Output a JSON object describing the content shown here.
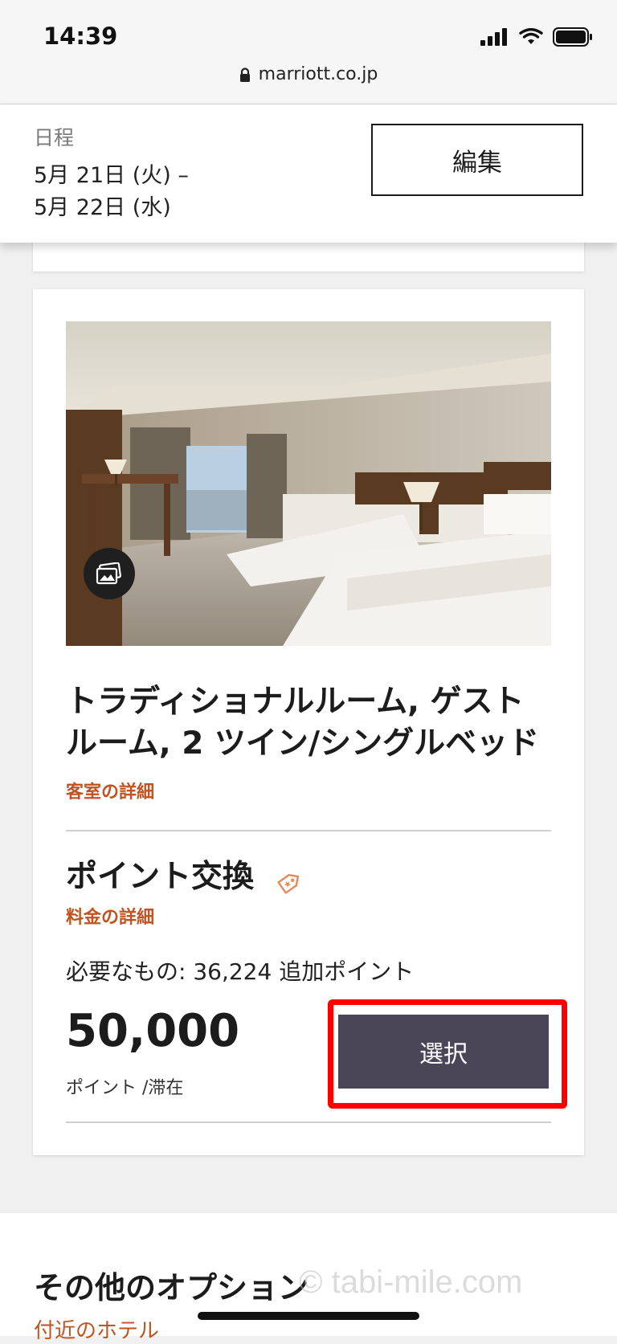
{
  "status_bar": {
    "time": "14:39",
    "url": "marriott.co.jp"
  },
  "header": {
    "date_label": "日程",
    "date_line1": "5月 21日 (火) –",
    "date_line2": "5月 22日 (水)",
    "edit_label": "編集"
  },
  "room": {
    "name": "トラディショナルルーム, ゲストルーム, 2 ツイン/シングルベッド",
    "details_link": "客室の詳細",
    "rate_title": "ポイント交換",
    "rate_details_link": "料金の詳細",
    "needed_text": "必要なもの: 36,224 追加ポイント",
    "price": "50,000",
    "price_unit": "ポイント /滞在",
    "select_label": "選択"
  },
  "other": {
    "title": "その他のオプション",
    "nearby_link": "付近のホテル"
  },
  "watermark": "© tabi-mile.com",
  "colors": {
    "accent_orange": "#c0531f",
    "select_button": "#4b4657",
    "highlight": "#ff0000"
  },
  "icons": [
    "lock-icon",
    "signal-icon",
    "wifi-icon",
    "battery-icon",
    "gallery-icon",
    "tag-icon"
  ]
}
